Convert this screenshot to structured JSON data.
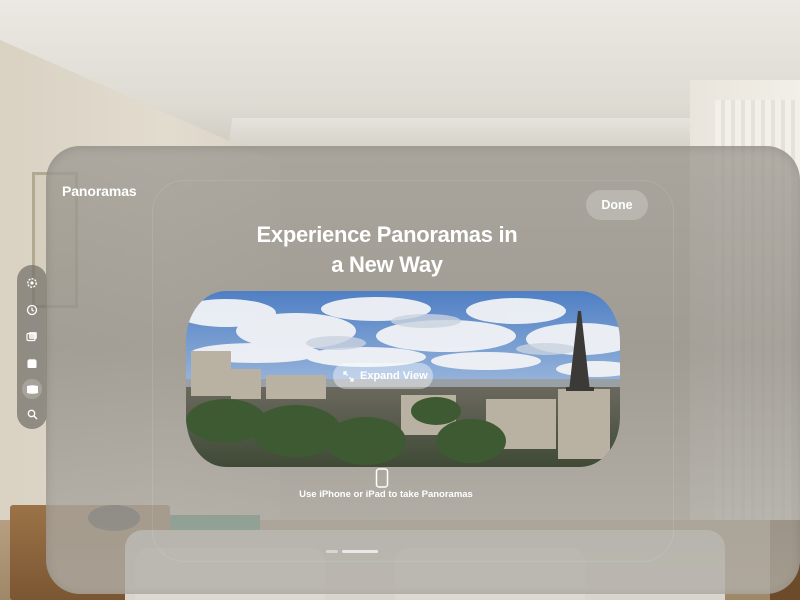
{
  "window": {
    "app_title": "Panoramas",
    "done_label": "Done"
  },
  "onboarding": {
    "headline_line1": "Experience Panoramas in",
    "headline_line2": "a New Way",
    "expand_label": "Expand View",
    "caption": "Use iPhone or iPad to take Panoramas"
  },
  "tabbar": {
    "items": [
      {
        "icon": "gear-icon",
        "active": false
      },
      {
        "icon": "recent-icon",
        "active": false
      },
      {
        "icon": "photos-icon",
        "active": false
      },
      {
        "icon": "albums-icon",
        "active": false
      },
      {
        "icon": "panoramas-icon",
        "active": true
      },
      {
        "icon": "search-icon",
        "active": false
      }
    ]
  },
  "colors": {
    "text": "#ffffff",
    "glass": "#9c9890",
    "sky": "#7f9ecb",
    "cloud": "#eef1f5"
  }
}
